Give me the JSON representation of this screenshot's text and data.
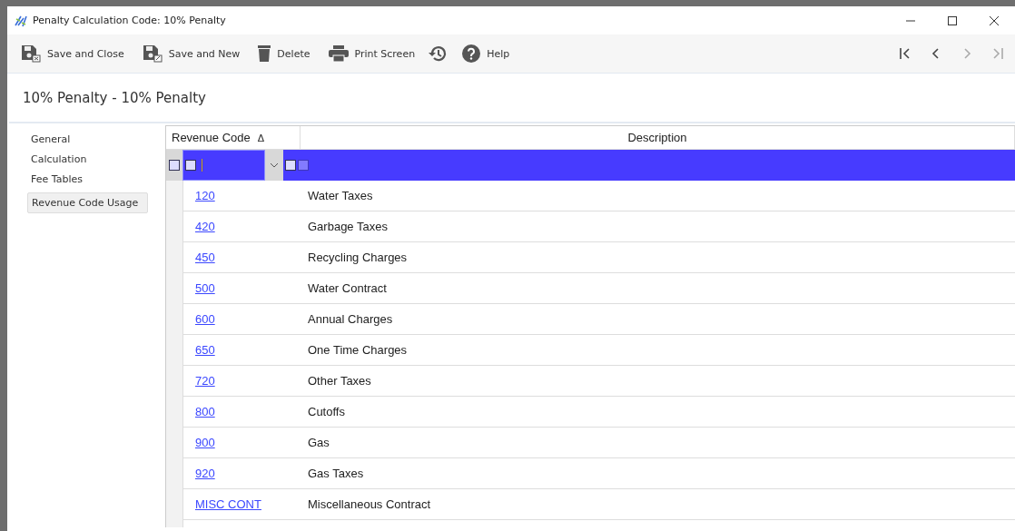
{
  "window": {
    "title": "Penalty Calculation Code: 10% Penalty"
  },
  "toolbar": [
    {
      "kind": "save-close",
      "label": "Save and Close"
    },
    {
      "kind": "save-new",
      "label": "Save and New"
    },
    {
      "kind": "delete",
      "label": "Delete"
    },
    {
      "kind": "print",
      "label": "Print Screen"
    },
    {
      "kind": "history"
    },
    {
      "kind": "help",
      "label": "Help"
    }
  ],
  "nav": [
    {
      "kind": "first",
      "disabled": false
    },
    {
      "kind": "prev",
      "disabled": false
    },
    {
      "kind": "next",
      "disabled": true
    },
    {
      "kind": "last",
      "disabled": true
    }
  ],
  "heading": "10% Penalty - 10% Penalty",
  "sidebar": {
    "items": [
      {
        "label": "General",
        "selected": false
      },
      {
        "label": "Calculation",
        "selected": false
      },
      {
        "label": "Fee Tables",
        "selected": false
      },
      {
        "label": "Revenue Code Usage",
        "selected": true
      }
    ]
  },
  "table": {
    "columns": [
      {
        "label": "Revenue Code",
        "sorted": true,
        "sort_indicator": "Δ"
      },
      {
        "label": "Description",
        "sorted": false
      }
    ],
    "rows": [
      {
        "code": "120",
        "description": "Water Taxes"
      },
      {
        "code": "420",
        "description": "Garbage Taxes"
      },
      {
        "code": "450",
        "description": "Recycling Charges"
      },
      {
        "code": "500",
        "description": "Water Contract"
      },
      {
        "code": "600",
        "description": "Annual Charges"
      },
      {
        "code": "650",
        "description": "One Time Charges"
      },
      {
        "code": "720",
        "description": "Other Taxes"
      },
      {
        "code": "800",
        "description": "Cutoffs"
      },
      {
        "code": "900",
        "description": "Gas"
      },
      {
        "code": "920",
        "description": "Gas Taxes"
      },
      {
        "code": "MISC CONT",
        "description": "Miscellaneous Contract"
      }
    ]
  }
}
